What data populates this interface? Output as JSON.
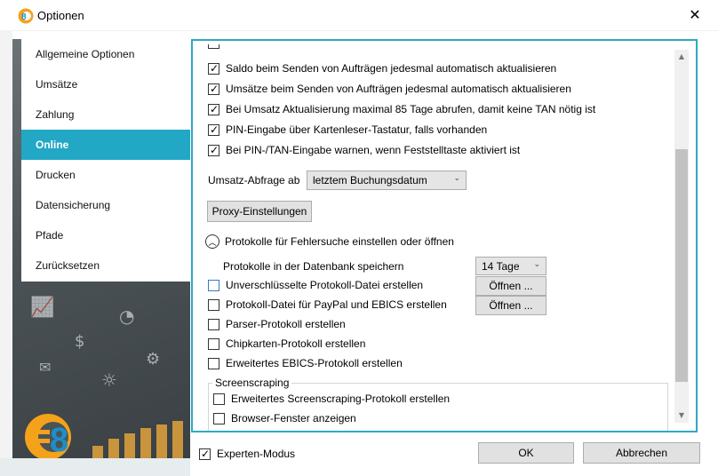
{
  "window": {
    "title": "Optionen",
    "close_glyph": "✕",
    "logo_text": "€8"
  },
  "nav": {
    "items": [
      {
        "label": "Allgemeine Optionen",
        "active": false
      },
      {
        "label": "Umsätze",
        "active": false
      },
      {
        "label": "Zahlung",
        "active": false
      },
      {
        "label": "Online",
        "active": true
      },
      {
        "label": "Drucken",
        "active": false
      },
      {
        "label": "Datensicherung",
        "active": false
      },
      {
        "label": "Pfade",
        "active": false
      },
      {
        "label": "Zurücksetzen",
        "active": false
      }
    ]
  },
  "online": {
    "checkboxes": [
      {
        "label": "Saldo beim Senden von Aufträgen jedesmal automatisch aktualisieren",
        "checked": true
      },
      {
        "label": "Umsätze beim Senden von Aufträgen jedesmal automatisch aktualisieren",
        "checked": true
      },
      {
        "label": "Bei Umsatz Aktualisierung maximal 85 Tage abrufen, damit keine TAN nötig ist",
        "checked": true
      },
      {
        "label": "PIN-Eingabe über Kartenleser-Tastatur, falls vorhanden",
        "checked": true
      },
      {
        "label": "Bei PIN-/TAN-Eingabe warnen, wenn Feststelltaste aktiviert ist",
        "checked": true
      }
    ],
    "umsatz_abfrage_label": "Umsatz-Abfrage ab",
    "umsatz_abfrage_value": "letztem Buchungsdatum",
    "proxy_button": "Proxy-Einstellungen",
    "protokolle_header": "Protokolle für Fehlersuche einstellen oder öffnen",
    "protokolle_db_label": "Protokolle in der Datenbank speichern",
    "protokolle_db_value": "14 Tage",
    "protokoll_checkboxes": [
      {
        "label": "Unverschlüsselte Protokoll-Datei erstellen",
        "checked": false
      },
      {
        "label": "Protokoll-Datei für PayPal und EBICS erstellen",
        "checked": false
      },
      {
        "label": "Parser-Protokoll erstellen",
        "checked": false
      },
      {
        "label": "Chipkarten-Protokoll erstellen",
        "checked": false
      },
      {
        "label": "Erweitertes EBICS-Protokoll erstellen",
        "checked": false
      }
    ],
    "open_button": "Öffnen ...",
    "screenscraping_label": "Screenscraping",
    "screenscraping_checkboxes": [
      {
        "label": "Erweitertes Screenscraping-Protokoll erstellen",
        "checked": false
      },
      {
        "label": "Browser-Fenster anzeigen",
        "checked": false
      }
    ]
  },
  "footer": {
    "expert_mode_label": "Experten-Modus",
    "expert_mode_checked": true,
    "ok_label": "OK",
    "cancel_label": "Abbrechen"
  },
  "colors": {
    "accent": "#22a7c5",
    "panel_border": "#2ea9c4"
  }
}
